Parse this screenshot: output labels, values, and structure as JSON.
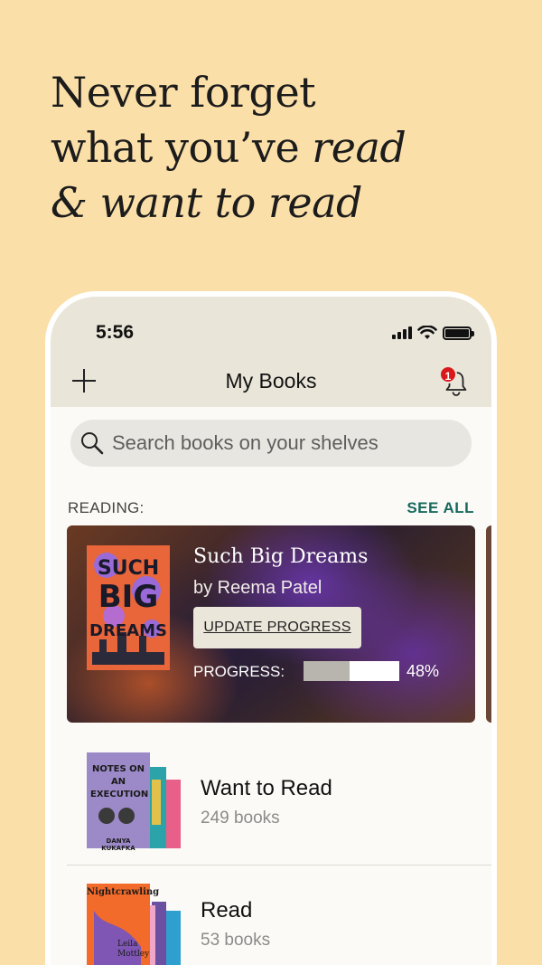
{
  "headline": {
    "line1": "Never forget",
    "line2_plain": "what you’ve ",
    "line2_italic": "read",
    "line3_italic": "& want to read"
  },
  "status_bar": {
    "time": "5:56"
  },
  "nav": {
    "title": "My Books",
    "notification_count": "1"
  },
  "search": {
    "placeholder": "Search books on your shelves"
  },
  "reading_section": {
    "label": "READING:",
    "see_all": "SEE ALL"
  },
  "current_book": {
    "title": "Such Big Dreams",
    "author": "by Reema Patel",
    "update_button": "UPDATE PROGRESS",
    "progress_label": "PROGRESS:",
    "progress_text": "48%",
    "progress_value": 0.48,
    "cover_text": "SUCH BIG DREAMS"
  },
  "shelves": [
    {
      "name": "Want to Read",
      "count": "249 books",
      "cover_title": "NOTES ON AN EXECUTION",
      "cover_author": "DANYA KUKAFKA"
    },
    {
      "name": "Read",
      "count": "53 books",
      "cover_title": "Nightcrawling",
      "cover_author": "Leila Mottley"
    }
  ],
  "colors": {
    "background": "#fbdfa8",
    "accent": "#17695e",
    "badge": "#d7191c"
  }
}
